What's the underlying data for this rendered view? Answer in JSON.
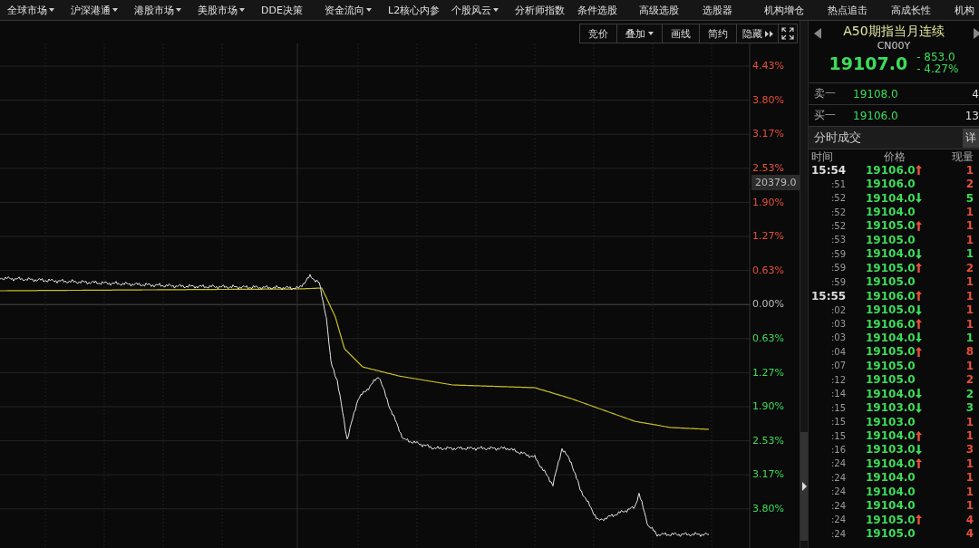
{
  "menu": [
    {
      "label": "全球市场",
      "dropdown": true
    },
    {
      "label": "沪深港通",
      "dropdown": true
    },
    {
      "label": "港股市场",
      "dropdown": true
    },
    {
      "label": "美股市场",
      "dropdown": true
    },
    {
      "label": "DDE决策",
      "dropdown": false
    },
    {
      "label": "资金流向",
      "dropdown": true
    },
    {
      "label": "L2核心内参",
      "dropdown": false
    },
    {
      "label": "个股风云",
      "dropdown": true
    },
    {
      "label": "分析师指数",
      "dropdown": false
    },
    {
      "label": "条件选股",
      "dropdown": false
    },
    {
      "label": "高级选股",
      "dropdown": false
    },
    {
      "label": "选股器",
      "dropdown": false
    },
    {
      "label": "机构增仓",
      "dropdown": false
    },
    {
      "label": "热点追击",
      "dropdown": false
    },
    {
      "label": "高成长性",
      "dropdown": false
    },
    {
      "label": "机构",
      "dropdown": false
    }
  ],
  "toolbar": [
    {
      "kind": "text",
      "label": "竞价"
    },
    {
      "kind": "dropdown",
      "label": "叠加"
    },
    {
      "kind": "text",
      "label": "画线"
    },
    {
      "kind": "text",
      "label": "简约"
    },
    {
      "kind": "more",
      "label": "隐藏"
    },
    {
      "kind": "fullscreen"
    }
  ],
  "chart": {
    "axis_ticks": [
      {
        "label": "4.43%",
        "color": "#e8503a"
      },
      {
        "label": "3.80%",
        "color": "#e8503a"
      },
      {
        "label": "3.17%",
        "color": "#e8503a"
      },
      {
        "label": "2.53%",
        "color": "#e8503a"
      },
      {
        "label": "1.90%",
        "color": "#e8503a"
      },
      {
        "label": "1.27%",
        "color": "#e8503a"
      },
      {
        "label": "0.63%",
        "color": "#e8503a"
      },
      {
        "label": "0.00%",
        "color": "#bbbbbb"
      },
      {
        "label": "0.63%",
        "color": "#3ddc5a"
      },
      {
        "label": "1.27%",
        "color": "#3ddc5a"
      },
      {
        "label": "1.90%",
        "color": "#3ddc5a"
      },
      {
        "label": "2.53%",
        "color": "#3ddc5a"
      },
      {
        "label": "3.17%",
        "color": "#3ddc5a"
      },
      {
        "label": "3.80%",
        "color": "#3ddc5a"
      }
    ],
    "price_tag": "20379.0"
  },
  "quote": {
    "title": "A50期指当月连续",
    "code": "CN00Y",
    "price": "19107.0",
    "change": "- 853.0",
    "change_pct": "- 4.27%"
  },
  "order_book": [
    {
      "label": "卖一",
      "price": "19108.0",
      "volume": "4"
    },
    {
      "label": "买一",
      "price": "19106.0",
      "volume": "13"
    }
  ],
  "trades": {
    "title": "分时成交",
    "detail_button": "详",
    "columns": [
      "时间",
      "价格",
      "现量"
    ],
    "rows": [
      {
        "time": "15:54",
        "major": true,
        "price": "19106.0",
        "kind": "up",
        "volume": "1",
        "color": "#e8503a"
      },
      {
        "time": ":51",
        "major": false,
        "price": "19106.0",
        "kind": "flat",
        "volume": "2",
        "color": "#e8503a"
      },
      {
        "time": ":52",
        "major": false,
        "price": "19104.0",
        "kind": "down",
        "volume": "5",
        "color": "#3ddc5a"
      },
      {
        "time": ":52",
        "major": false,
        "price": "19104.0",
        "kind": "flat",
        "volume": "1",
        "color": "#e8503a"
      },
      {
        "time": ":52",
        "major": false,
        "price": "19105.0",
        "kind": "up",
        "volume": "1",
        "color": "#e8503a"
      },
      {
        "time": ":53",
        "major": false,
        "price": "19105.0",
        "kind": "flat",
        "volume": "1",
        "color": "#e8503a"
      },
      {
        "time": ":59",
        "major": false,
        "price": "19104.0",
        "kind": "down",
        "volume": "1",
        "color": "#3ddc5a"
      },
      {
        "time": ":59",
        "major": false,
        "price": "19105.0",
        "kind": "up",
        "volume": "2",
        "color": "#e8503a"
      },
      {
        "time": ":59",
        "major": false,
        "price": "19105.0",
        "kind": "flat",
        "volume": "1",
        "color": "#e8503a"
      },
      {
        "time": "15:55",
        "major": true,
        "price": "19106.0",
        "kind": "up",
        "volume": "1",
        "color": "#e8503a"
      },
      {
        "time": ":02",
        "major": false,
        "price": "19105.0",
        "kind": "down",
        "volume": "1",
        "color": "#e8503a"
      },
      {
        "time": ":03",
        "major": false,
        "price": "19106.0",
        "kind": "up",
        "volume": "1",
        "color": "#e8503a"
      },
      {
        "time": ":03",
        "major": false,
        "price": "19104.0",
        "kind": "down",
        "volume": "1",
        "color": "#3ddc5a"
      },
      {
        "time": ":04",
        "major": false,
        "price": "19105.0",
        "kind": "up",
        "volume": "8",
        "color": "#e8503a"
      },
      {
        "time": ":07",
        "major": false,
        "price": "19105.0",
        "kind": "flat",
        "volume": "1",
        "color": "#e8503a"
      },
      {
        "time": ":12",
        "major": false,
        "price": "19105.0",
        "kind": "flat",
        "volume": "2",
        "color": "#e8503a"
      },
      {
        "time": ":14",
        "major": false,
        "price": "19104.0",
        "kind": "down",
        "volume": "2",
        "color": "#3ddc5a"
      },
      {
        "time": ":15",
        "major": false,
        "price": "19103.0",
        "kind": "down",
        "volume": "3",
        "color": "#3ddc5a"
      },
      {
        "time": ":15",
        "major": false,
        "price": "19103.0",
        "kind": "flat",
        "volume": "1",
        "color": "#e8503a"
      },
      {
        "time": ":15",
        "major": false,
        "price": "19104.0",
        "kind": "up",
        "volume": "1",
        "color": "#e8503a"
      },
      {
        "time": ":16",
        "major": false,
        "price": "19103.0",
        "kind": "down",
        "volume": "3",
        "color": "#e8503a"
      },
      {
        "time": ":24",
        "major": false,
        "price": "19104.0",
        "kind": "up",
        "volume": "1",
        "color": "#e8503a"
      },
      {
        "time": ":24",
        "major": false,
        "price": "19104.0",
        "kind": "flat",
        "volume": "1",
        "color": "#e8503a"
      },
      {
        "time": ":24",
        "major": false,
        "price": "19104.0",
        "kind": "flat",
        "volume": "1",
        "color": "#e8503a"
      },
      {
        "time": ":24",
        "major": false,
        "price": "19104.0",
        "kind": "flat",
        "volume": "1",
        "color": "#e8503a"
      },
      {
        "time": ":24",
        "major": false,
        "price": "19105.0",
        "kind": "up",
        "volume": "4",
        "color": "#e8503a"
      },
      {
        "time": ":24",
        "major": false,
        "price": "19105.0",
        "kind": "flat",
        "volume": "4",
        "color": "#e8503a"
      }
    ]
  }
}
